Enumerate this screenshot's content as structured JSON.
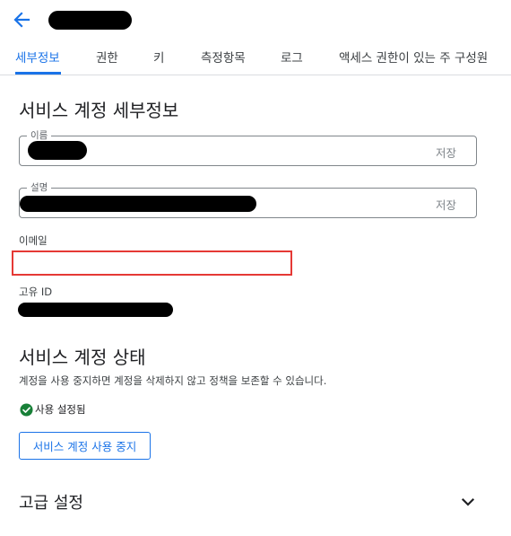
{
  "tabs": [
    {
      "label": "세부정보",
      "active": true
    },
    {
      "label": "권한"
    },
    {
      "label": "키"
    },
    {
      "label": "측정항목"
    },
    {
      "label": "로그"
    },
    {
      "label": "액세스 권한이 있는 주 구성원"
    }
  ],
  "details": {
    "title": "서비스 계정 세부정보",
    "name_field": {
      "label": "이름",
      "save": "저장"
    },
    "description_field": {
      "label": "설명",
      "save": "저장"
    },
    "email_label": "이메일",
    "unique_id_label": "고유 ID"
  },
  "status_section": {
    "title": "서비스 계정 상태",
    "description": "계정을 사용 중지하면 계정을 삭제하지 않고 정책을 보존할 수 있습니다.",
    "status_text": "사용 설정됨",
    "disable_button": "서비스 계정 사용 중지"
  },
  "advanced": {
    "title": "고급 설정"
  },
  "colors": {
    "accent": "#1a73e8",
    "success": "#188038",
    "highlight_border": "#e53935"
  },
  "icons": {
    "back": "arrow-left",
    "status": "check-circle",
    "expand": "chevron-down"
  }
}
